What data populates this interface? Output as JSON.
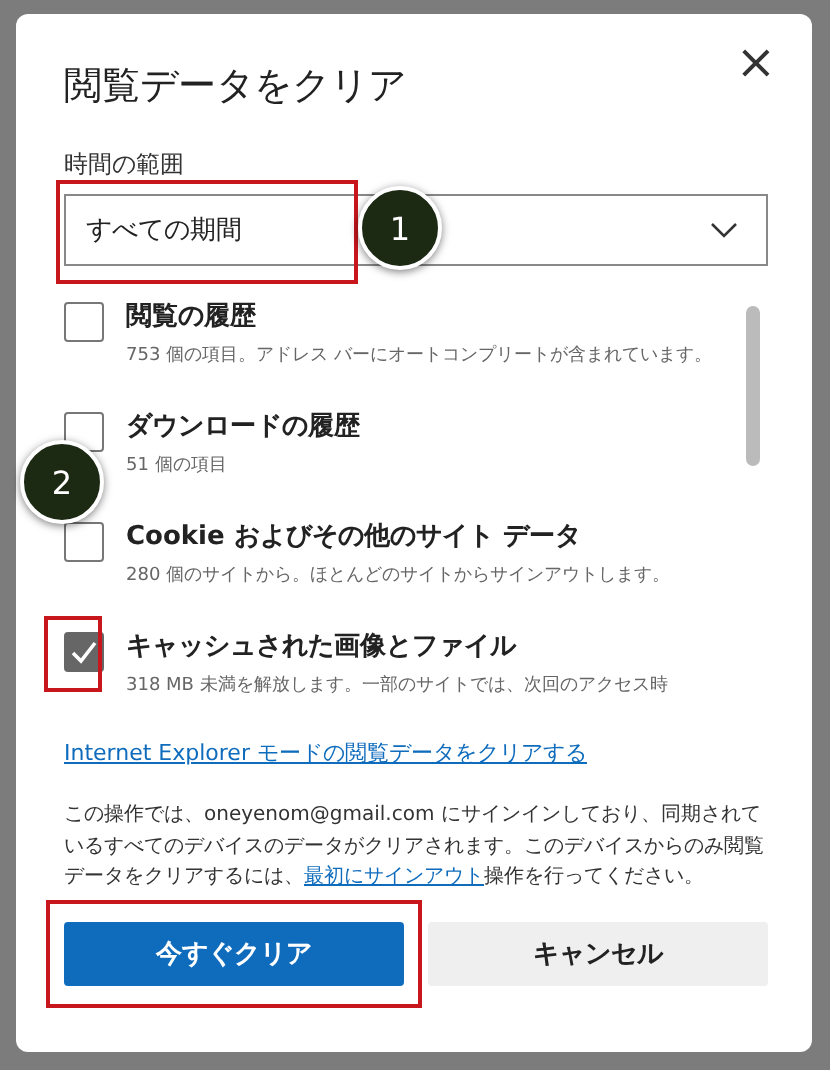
{
  "dialog": {
    "title": "閲覧データをクリア",
    "close": "×",
    "time_range": {
      "label": "時間の範囲",
      "value": "すべての期間"
    },
    "items": [
      {
        "title": "閲覧の履歴",
        "detail": "753 個の項目。アドレス バーにオートコンプリートが含まれています。",
        "checked": false
      },
      {
        "title": "ダウンロードの履歴",
        "detail": "51 個の項目",
        "checked": false
      },
      {
        "title": "Cookie およびその他のサイト データ",
        "detail": "280 個のサイトから。ほとんどのサイトからサインアウトします。",
        "checked": false
      },
      {
        "title": "キャッシュされた画像とファイル",
        "detail": "318 MB 未満を解放します。一部のサイトでは、次回のアクセス時",
        "checked": true
      }
    ],
    "ie_link": "Internet Explorer モードの閲覧データをクリアする",
    "notice": {
      "before": "この操作では、oneyenom@gmail.com にサインインしており、同期されているすべてのデバイスのデータがクリアされます。このデバイスからのみ閲覧データをクリアするには、",
      "link": "最初にサインアウト",
      "after": "操作を行ってください。"
    },
    "buttons": [
      {
        "label": "今すぐクリア",
        "kind": "primary"
      },
      {
        "label": "キャンセル",
        "kind": "secondary"
      }
    ]
  },
  "annotations": [
    {
      "label": "1"
    },
    {
      "label": "2"
    }
  ]
}
